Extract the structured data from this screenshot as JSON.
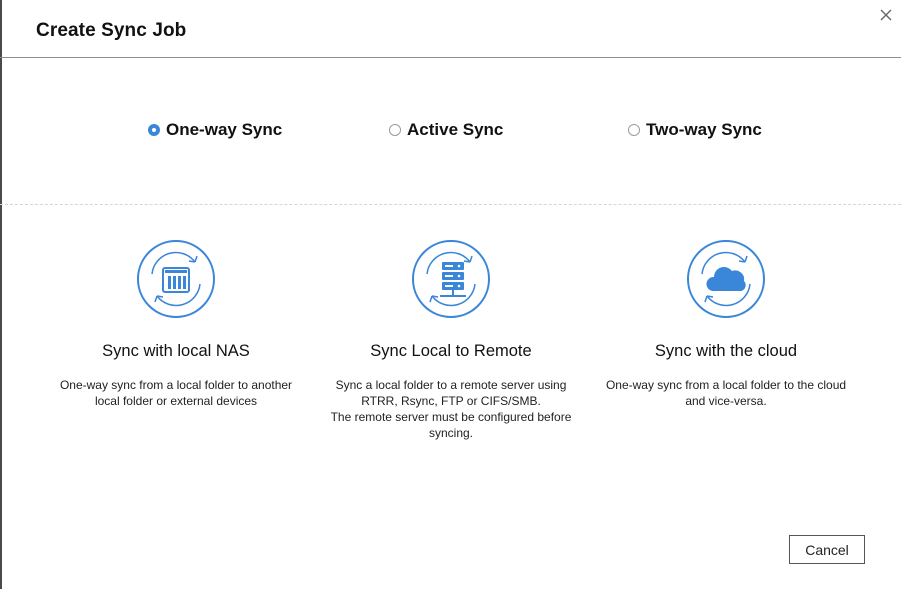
{
  "dialog": {
    "title": "Create Sync Job",
    "close_icon": "close-icon"
  },
  "sync_modes": [
    {
      "label": "One-way Sync",
      "selected": true
    },
    {
      "label": "Active Sync",
      "selected": false
    },
    {
      "label": "Two-way Sync",
      "selected": false
    }
  ],
  "options": [
    {
      "icon": "nas-sync-icon",
      "title": "Sync with local NAS",
      "description": "One-way sync from a local folder to another\nlocal folder or external devices"
    },
    {
      "icon": "server-sync-icon",
      "title": "Sync Local to Remote",
      "description": "Sync a local folder to a remote server using\nRTRR, Rsync, FTP or CIFS/SMB.\nThe remote server must be configured before\nsyncing."
    },
    {
      "icon": "cloud-sync-icon",
      "title": "Sync with the cloud",
      "description": "One-way sync from a local folder to the cloud\nand vice-versa."
    }
  ],
  "footer": {
    "cancel_label": "Cancel"
  },
  "colors": {
    "accent": "#3a86d8"
  }
}
